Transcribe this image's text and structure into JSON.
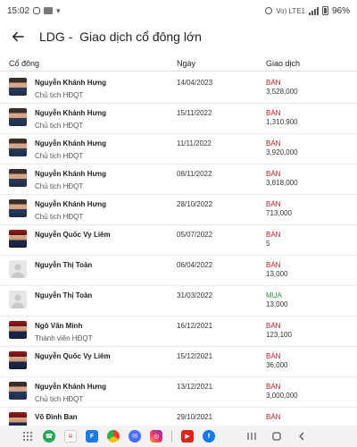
{
  "status_bar": {
    "time": "15:02",
    "network": "Vo) LTE1",
    "battery": "96%"
  },
  "header": {
    "title": "LDG -  Giao dịch cổ đông lớn",
    "back_icon": "arrow-left-icon"
  },
  "columns": {
    "holder": "Cổ đông",
    "date": "Ngày",
    "transaction": "Giao dịch"
  },
  "rows": [
    {
      "name": "Nguyễn Khánh Hưng",
      "title": "Chủ tịch HĐQT",
      "date": "14/04/2023",
      "action": "BÁN",
      "quantity": "3,528,000",
      "avatar": "photo"
    },
    {
      "name": "Nguyễn Khánh Hưng",
      "title": "Chủ tịch HĐQT",
      "date": "15/11/2022",
      "action": "BÁN",
      "quantity": "1,310,900",
      "avatar": "photo"
    },
    {
      "name": "Nguyễn Khánh Hưng",
      "title": "Chủ tịch HĐQT",
      "date": "11/11/2022",
      "action": "BÁN",
      "quantity": "3,920,000",
      "avatar": "photo"
    },
    {
      "name": "Nguyễn Khánh Hưng",
      "title": "Chủ tịch HĐQT",
      "date": "08/11/2022",
      "action": "BÁN",
      "quantity": "3,818,000",
      "avatar": "photo"
    },
    {
      "name": "Nguyễn Khánh Hưng",
      "title": "Chủ tịch HĐQT",
      "date": "28/10/2022",
      "action": "BÁN",
      "quantity": "713,000",
      "avatar": "photo"
    },
    {
      "name": "Nguyễn Quốc Vy Liêm",
      "title": "",
      "date": "05/07/2022",
      "action": "BÁN",
      "quantity": "5",
      "avatar": "photo-red"
    },
    {
      "name": "Nguyễn Thị Toàn",
      "title": "",
      "date": "06/04/2022",
      "action": "BÁN",
      "quantity": "13,000",
      "avatar": "blank"
    },
    {
      "name": "Nguyễn Thị Toàn",
      "title": "",
      "date": "31/03/2022",
      "action": "MUA",
      "quantity": "13,000",
      "avatar": "blank"
    },
    {
      "name": "Ngô Văn Minh",
      "title": "Thành viên HĐQT",
      "date": "16/12/2021",
      "action": "BÁN",
      "quantity": "123,100",
      "avatar": "photo-red"
    },
    {
      "name": "Nguyễn Quốc Vy Liêm",
      "title": "",
      "date": "15/12/2021",
      "action": "BÁN",
      "quantity": "36,000",
      "avatar": "photo-red"
    },
    {
      "name": "Nguyễn Khánh Hưng",
      "title": "Chủ tịch HĐQT",
      "date": "13/12/2021",
      "action": "BÁN",
      "quantity": "3,000,000",
      "avatar": "photo"
    },
    {
      "name": "Võ Đình Ban",
      "title": "",
      "date": "29/10/2021",
      "action": "BÁN",
      "quantity": "",
      "avatar": "photo-red"
    }
  ],
  "colors": {
    "sell": "#a8232a",
    "buy": "#2e8b3a"
  },
  "nav_bar": {
    "apps": [
      "phone-app-icon",
      "news-app-icon",
      "finance-app-icon",
      "chrome-icon",
      "messages-icon",
      "instagram-icon",
      "youtube-icon",
      "facebook-icon"
    ],
    "controls": [
      "back-nav-icon",
      "home-nav-icon",
      "recents-nav-icon"
    ]
  }
}
